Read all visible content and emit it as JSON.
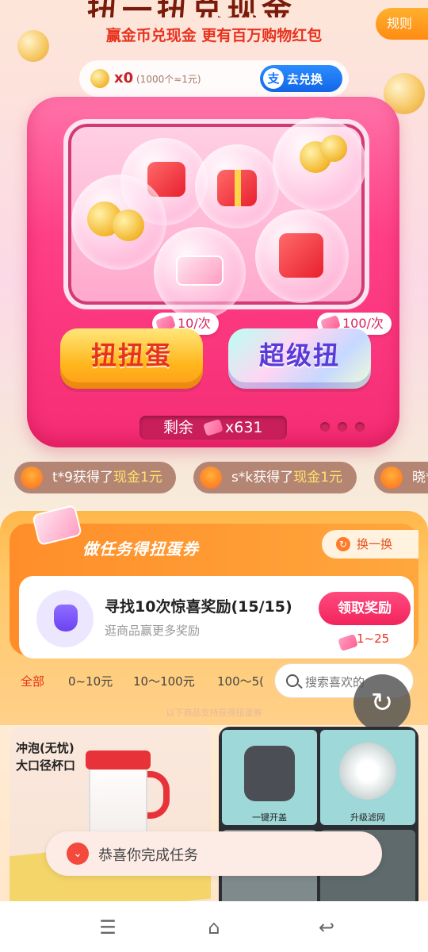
{
  "header": {
    "title": "扭一扭兑现金",
    "subtitle": "赢金币兑现金 更有百万购物红包",
    "rules_label": "规则"
  },
  "balance": {
    "count": "x0",
    "rate": "(1000个≈1元)",
    "exchange_label": "去兑换",
    "alipay_glyph": "支"
  },
  "machine": {
    "twist": {
      "label": "扭扭蛋",
      "price": "10/次"
    },
    "super": {
      "label": "超级扭",
      "price": "100/次"
    },
    "remaining_label": "剩余",
    "remaining_count": "x631"
  },
  "winners": [
    {
      "name": "t*9获得了",
      "prize": "现金1元"
    },
    {
      "name": "s*k获得了",
      "prize": "现金1元"
    },
    {
      "name": "晓*",
      "prize": ""
    }
  ],
  "tasks": {
    "title": "做任务得扭蛋券",
    "swap_label": "换一换",
    "item": {
      "name": "寻找10次惊喜奖励(15/15)",
      "desc": "逛商品赢更多奖励",
      "claim_label": "领取奖励",
      "reward": "1~25"
    }
  },
  "filters": {
    "tabs": [
      "全部",
      "0~10元",
      "10～100元",
      "100～5("
    ],
    "active_index": 0,
    "search_placeholder": "搜索喜欢的"
  },
  "hint": "以下商品支持获得扭蛋券",
  "products": {
    "left_label": [
      "冲泡(无忧)",
      "大口径杯口"
    ],
    "right_captions": [
      "一键开盖",
      "升级滤网"
    ]
  },
  "toast": {
    "text": "恭喜你完成任务"
  },
  "nav": {
    "menu": "☰",
    "home": "⌂",
    "back": "↩"
  },
  "colors": {
    "accent": "#e8321e",
    "pink": "#ff3f86",
    "orange": "#ffa73c"
  }
}
